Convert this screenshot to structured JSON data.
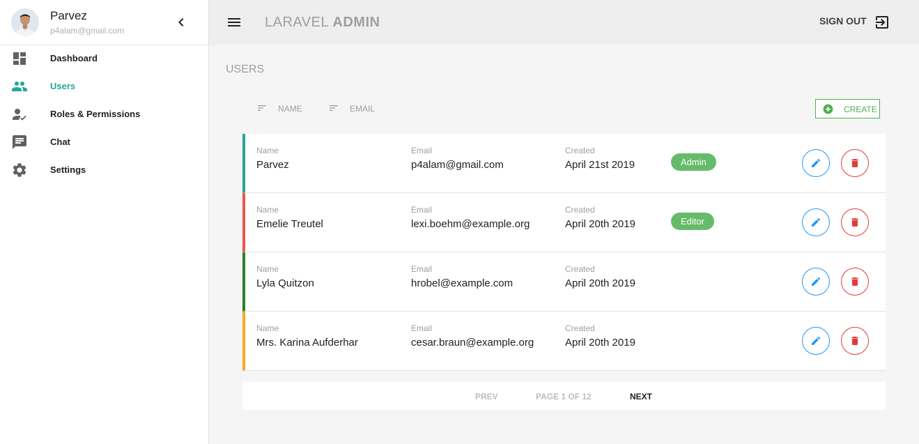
{
  "profile": {
    "name": "Parvez",
    "email": "p4alam@gmail.com"
  },
  "sidebar": {
    "items": [
      {
        "label": "Dashboard",
        "icon": "dashboard-icon"
      },
      {
        "label": "Users",
        "icon": "people-icon",
        "active": true
      },
      {
        "label": "Roles & Permissions",
        "icon": "person-check-icon"
      },
      {
        "label": "Chat",
        "icon": "chat-icon"
      },
      {
        "label": "Settings",
        "icon": "gear-icon"
      }
    ]
  },
  "header": {
    "title_light": "LARAVEL",
    "title_bold": "ADMIN",
    "signout_label": "SIGN OUT"
  },
  "main": {
    "page_title": "USERS",
    "sort": {
      "name_label": "NAME",
      "email_label": "EMAIL"
    },
    "create_label": "CREATE",
    "columns": {
      "name": "Name",
      "email": "Email",
      "created": "Created"
    },
    "users": [
      {
        "name": "Parvez",
        "email": "p4alam@gmail.com",
        "created": "April 21st 2019",
        "role": "Admin",
        "accent": "#26a69a"
      },
      {
        "name": "Emelie Treutel",
        "email": "lexi.boehm@example.org",
        "created": "April 20th 2019",
        "role": "Editor",
        "accent": "#ef5350"
      },
      {
        "name": "Lyla Quitzon",
        "email": "hrobel@example.com",
        "created": "April 20th 2019",
        "role": "",
        "accent": "#2e7d32"
      },
      {
        "name": "Mrs. Karina Aufderhar",
        "email": "cesar.braun@example.org",
        "created": "April 20th 2019",
        "role": "",
        "accent": "#ffa726"
      }
    ]
  },
  "pagination": {
    "prev_label": "PREV",
    "page_info": "PAGE 1 OF 12",
    "next_label": "NEXT"
  },
  "colors": {
    "accent": "#26a69a",
    "create": "#4caf50",
    "edit": "#2196f3",
    "delete": "#e53935",
    "badge": "#66bb6a"
  }
}
